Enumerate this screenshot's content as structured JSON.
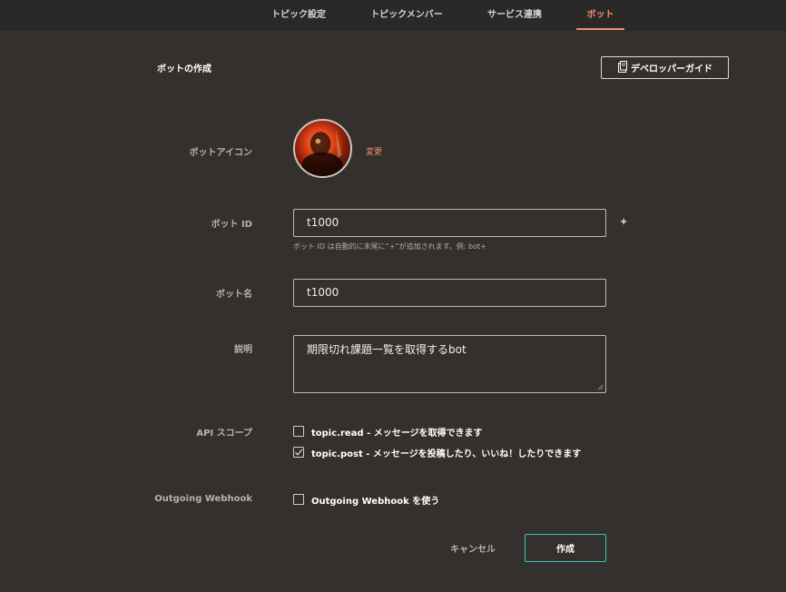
{
  "tabs": [
    {
      "label": "トピック設定"
    },
    {
      "label": "トピックメンバー"
    },
    {
      "label": "サービス連携"
    },
    {
      "label": "ボット",
      "active": true
    }
  ],
  "header": {
    "title": "ボットの作成",
    "guide_button": "デベロッパーガイド",
    "guide_icon": "document-icon"
  },
  "form": {
    "icon_label": "ボットアイコン",
    "icon_change": "変更",
    "bot_id_label": "ボット ID",
    "bot_id_value": "t1000",
    "bot_id_suffix": "+",
    "bot_id_hint": "ボット ID は自動的に末尾に“+”が追加されます。例: bot+",
    "bot_name_label": "ボット名",
    "bot_name_value": "t1000",
    "description_label": "説明",
    "description_value": "期限切れ課題一覧を取得するbot",
    "api_scope_label": "API スコープ",
    "scopes": [
      {
        "label": "topic.read - メッセージを取得できます",
        "checked": false
      },
      {
        "label": "topic.post - メッセージを投稿したり、いいね！したりできます",
        "checked": true
      }
    ],
    "webhook_label": "Outgoing Webhook",
    "webhook_option": {
      "label": "Outgoing Webhook を使う",
      "checked": false
    }
  },
  "actions": {
    "cancel": "キャンセル",
    "create": "作成"
  },
  "colors": {
    "background": "#33302e",
    "tabbar": "#2b2928",
    "accent": "#f28f6e",
    "primary_border": "#34c6b4"
  }
}
